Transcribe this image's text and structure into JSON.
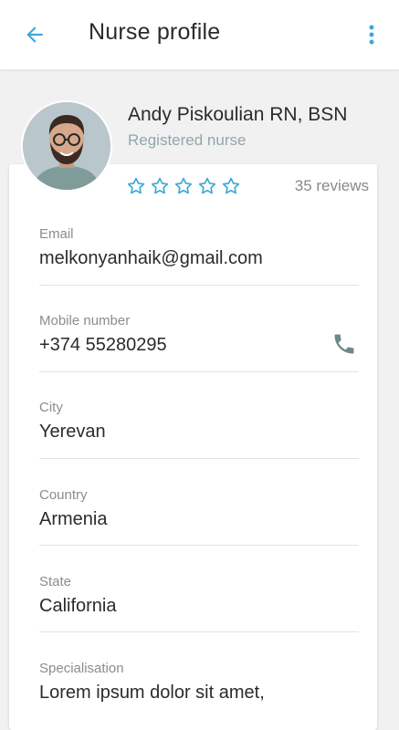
{
  "appbar": {
    "title": "Nurse profile",
    "back_icon": "arrow-left-icon",
    "menu_icon": "more-vertical-icon",
    "accent_color": "#3aa9d6"
  },
  "profile": {
    "name": "Andy Piskoulian RN, BSN",
    "role": "Registered nurse",
    "rating": {
      "value": 0,
      "max": 5
    },
    "reviews": "35 reviews"
  },
  "fields": [
    {
      "label": "Email",
      "value": "melkonyanhaik@gmail.com"
    },
    {
      "label": "Mobile number",
      "value": "+374 55280295",
      "action_icon": "phone-icon"
    },
    {
      "label": "City",
      "value": "Yerevan"
    },
    {
      "label": "Country",
      "value": "Armenia"
    },
    {
      "label": "State",
      "value": "California"
    },
    {
      "label": "Specialisation",
      "value": "Lorem ipsum dolor sit amet,"
    }
  ]
}
